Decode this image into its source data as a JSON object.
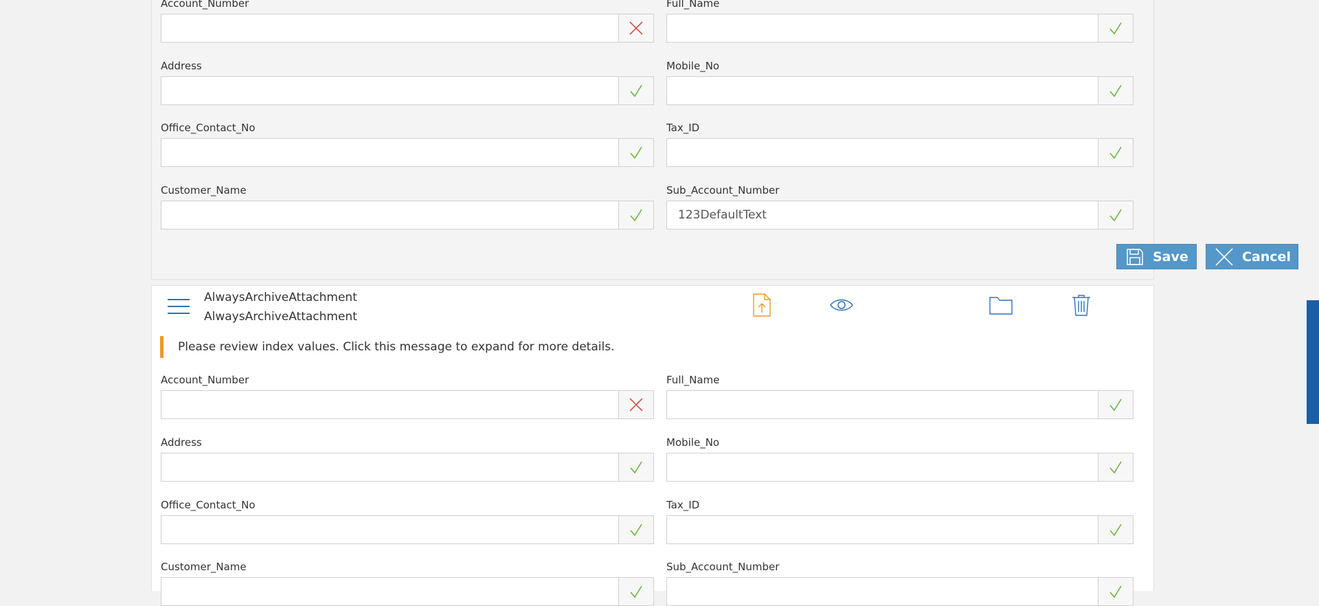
{
  "form1": {
    "fields": [
      {
        "label": "Account_Number",
        "value": "",
        "status": "invalid"
      },
      {
        "label": "Full_Name",
        "value": "",
        "status": "valid"
      },
      {
        "label": "Address",
        "value": "",
        "status": "valid"
      },
      {
        "label": "Mobile_No",
        "value": "",
        "status": "valid"
      },
      {
        "label": "Office_Contact_No",
        "value": "",
        "status": "valid"
      },
      {
        "label": "Tax_ID",
        "value": "",
        "status": "valid"
      },
      {
        "label": "Customer_Name",
        "value": "",
        "status": "valid"
      },
      {
        "label": "Sub_Account_Number",
        "value": "123DefaultText",
        "status": "valid"
      }
    ],
    "save_label": "Save",
    "cancel_label": "Cancel"
  },
  "document": {
    "name_line1": "AlwaysArchiveAttachment",
    "name_line2": "AlwaysArchiveAttachment",
    "toolbar_icons": [
      "upload-file-icon",
      "eye-icon",
      "folder-icon",
      "trash-icon"
    ],
    "alert_message": "Please review index values. Click this message to expand for more details."
  },
  "form2": {
    "fields": [
      {
        "label": "Account_Number",
        "value": "",
        "status": "invalid"
      },
      {
        "label": "Full_Name",
        "value": "",
        "status": "valid"
      },
      {
        "label": "Address",
        "value": "",
        "status": "valid"
      },
      {
        "label": "Mobile_No",
        "value": "",
        "status": "valid"
      },
      {
        "label": "Office_Contact_No",
        "value": "",
        "status": "valid"
      },
      {
        "label": "Tax_ID",
        "value": "",
        "status": "valid"
      },
      {
        "label": "Customer_Name",
        "value": "",
        "status": "valid"
      },
      {
        "label": "Sub_Account_Number",
        "value": "",
        "status": "valid"
      }
    ]
  },
  "colors": {
    "accent": "#5497c9",
    "icon_blue": "#2e72b5",
    "valid": "#6fb43f",
    "invalid": "#d9534f",
    "warning": "#f0972a"
  }
}
